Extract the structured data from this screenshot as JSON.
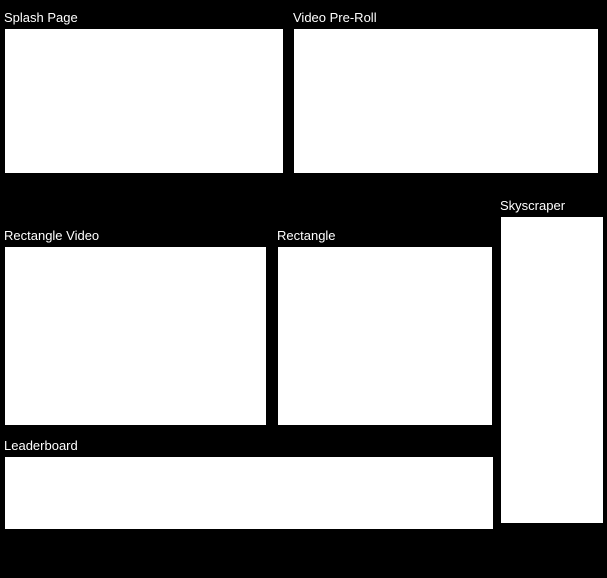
{
  "units": {
    "splash": {
      "label": "Splash Page"
    },
    "preroll": {
      "label": "Video Pre-Roll"
    },
    "rectvid": {
      "label": "Rectangle Video"
    },
    "rect": {
      "label": "Rectangle"
    },
    "sky": {
      "label": "Skyscraper"
    },
    "leader": {
      "label": "Leaderboard"
    }
  }
}
